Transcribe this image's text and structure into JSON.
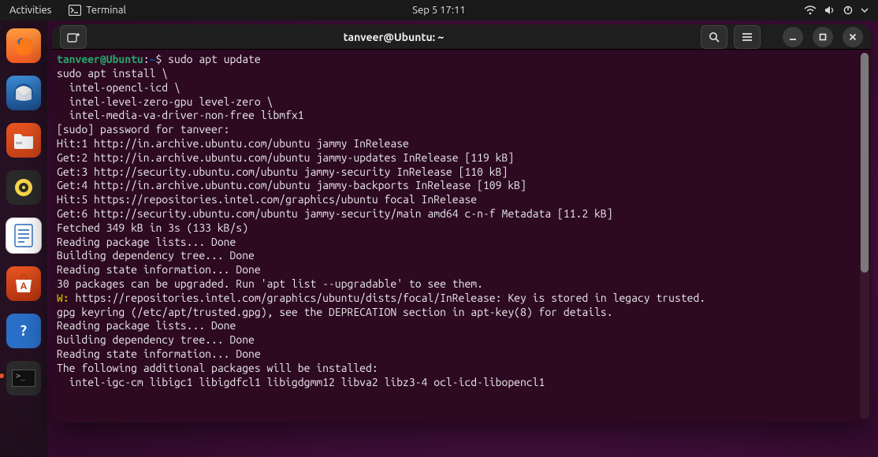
{
  "topbar": {
    "activities": "Activities",
    "app_label": "Terminal",
    "clock": "Sep 5  17:11"
  },
  "dock": {
    "items": [
      {
        "name": "firefox"
      },
      {
        "name": "thunderbird"
      },
      {
        "name": "files"
      },
      {
        "name": "rhythmbox"
      },
      {
        "name": "libreoffice-writer"
      },
      {
        "name": "ubuntu-software"
      },
      {
        "name": "help"
      },
      {
        "name": "terminal",
        "active": true
      }
    ]
  },
  "window": {
    "title": "tanveer@Ubuntu: ~"
  },
  "terminal": {
    "prompt": {
      "user_host": "tanveer@Ubuntu",
      "path": "~",
      "sep": ":",
      "dollar": "$"
    },
    "command": "sudo apt update",
    "lines": [
      "sudo apt install \\",
      "  intel-opencl-icd \\",
      "  intel-level-zero-gpu level-zero \\",
      "  intel-media-va-driver-non-free libmfx1",
      "[sudo] password for tanveer:",
      "Hit:1 http://in.archive.ubuntu.com/ubuntu jammy InRelease",
      "Get:2 http://in.archive.ubuntu.com/ubuntu jammy-updates InRelease [119 kB]",
      "Get:3 http://security.ubuntu.com/ubuntu jammy-security InRelease [110 kB]",
      "Get:4 http://in.archive.ubuntu.com/ubuntu jammy-backports InRelease [109 kB]",
      "Hit:5 https://repositories.intel.com/graphics/ubuntu focal InRelease",
      "Get:6 http://security.ubuntu.com/ubuntu jammy-security/main amd64 c-n-f Metadata [11.2 kB]",
      "Fetched 349 kB in 3s (133 kB/s)",
      "Reading package lists... Done",
      "Building dependency tree... Done",
      "Reading state information... Done",
      "30 packages can be upgraded. Run 'apt list --upgradable' to see them."
    ],
    "warn_prefix": "W:",
    "warn_text": " https://repositories.intel.com/graphics/ubuntu/dists/focal/InRelease: Key is stored in legacy trusted.",
    "post_warn": [
      "gpg keyring (/etc/apt/trusted.gpg), see the DEPRECATION section in apt-key(8) for details.",
      "Reading package lists... Done",
      "Building dependency tree... Done",
      "Reading state information... Done",
      "The following additional packages will be installed:",
      "  intel-igc-cm libigc1 libigdfcl1 libigdgmm12 libva2 libz3-4 ocl-icd-libopencl1"
    ]
  }
}
